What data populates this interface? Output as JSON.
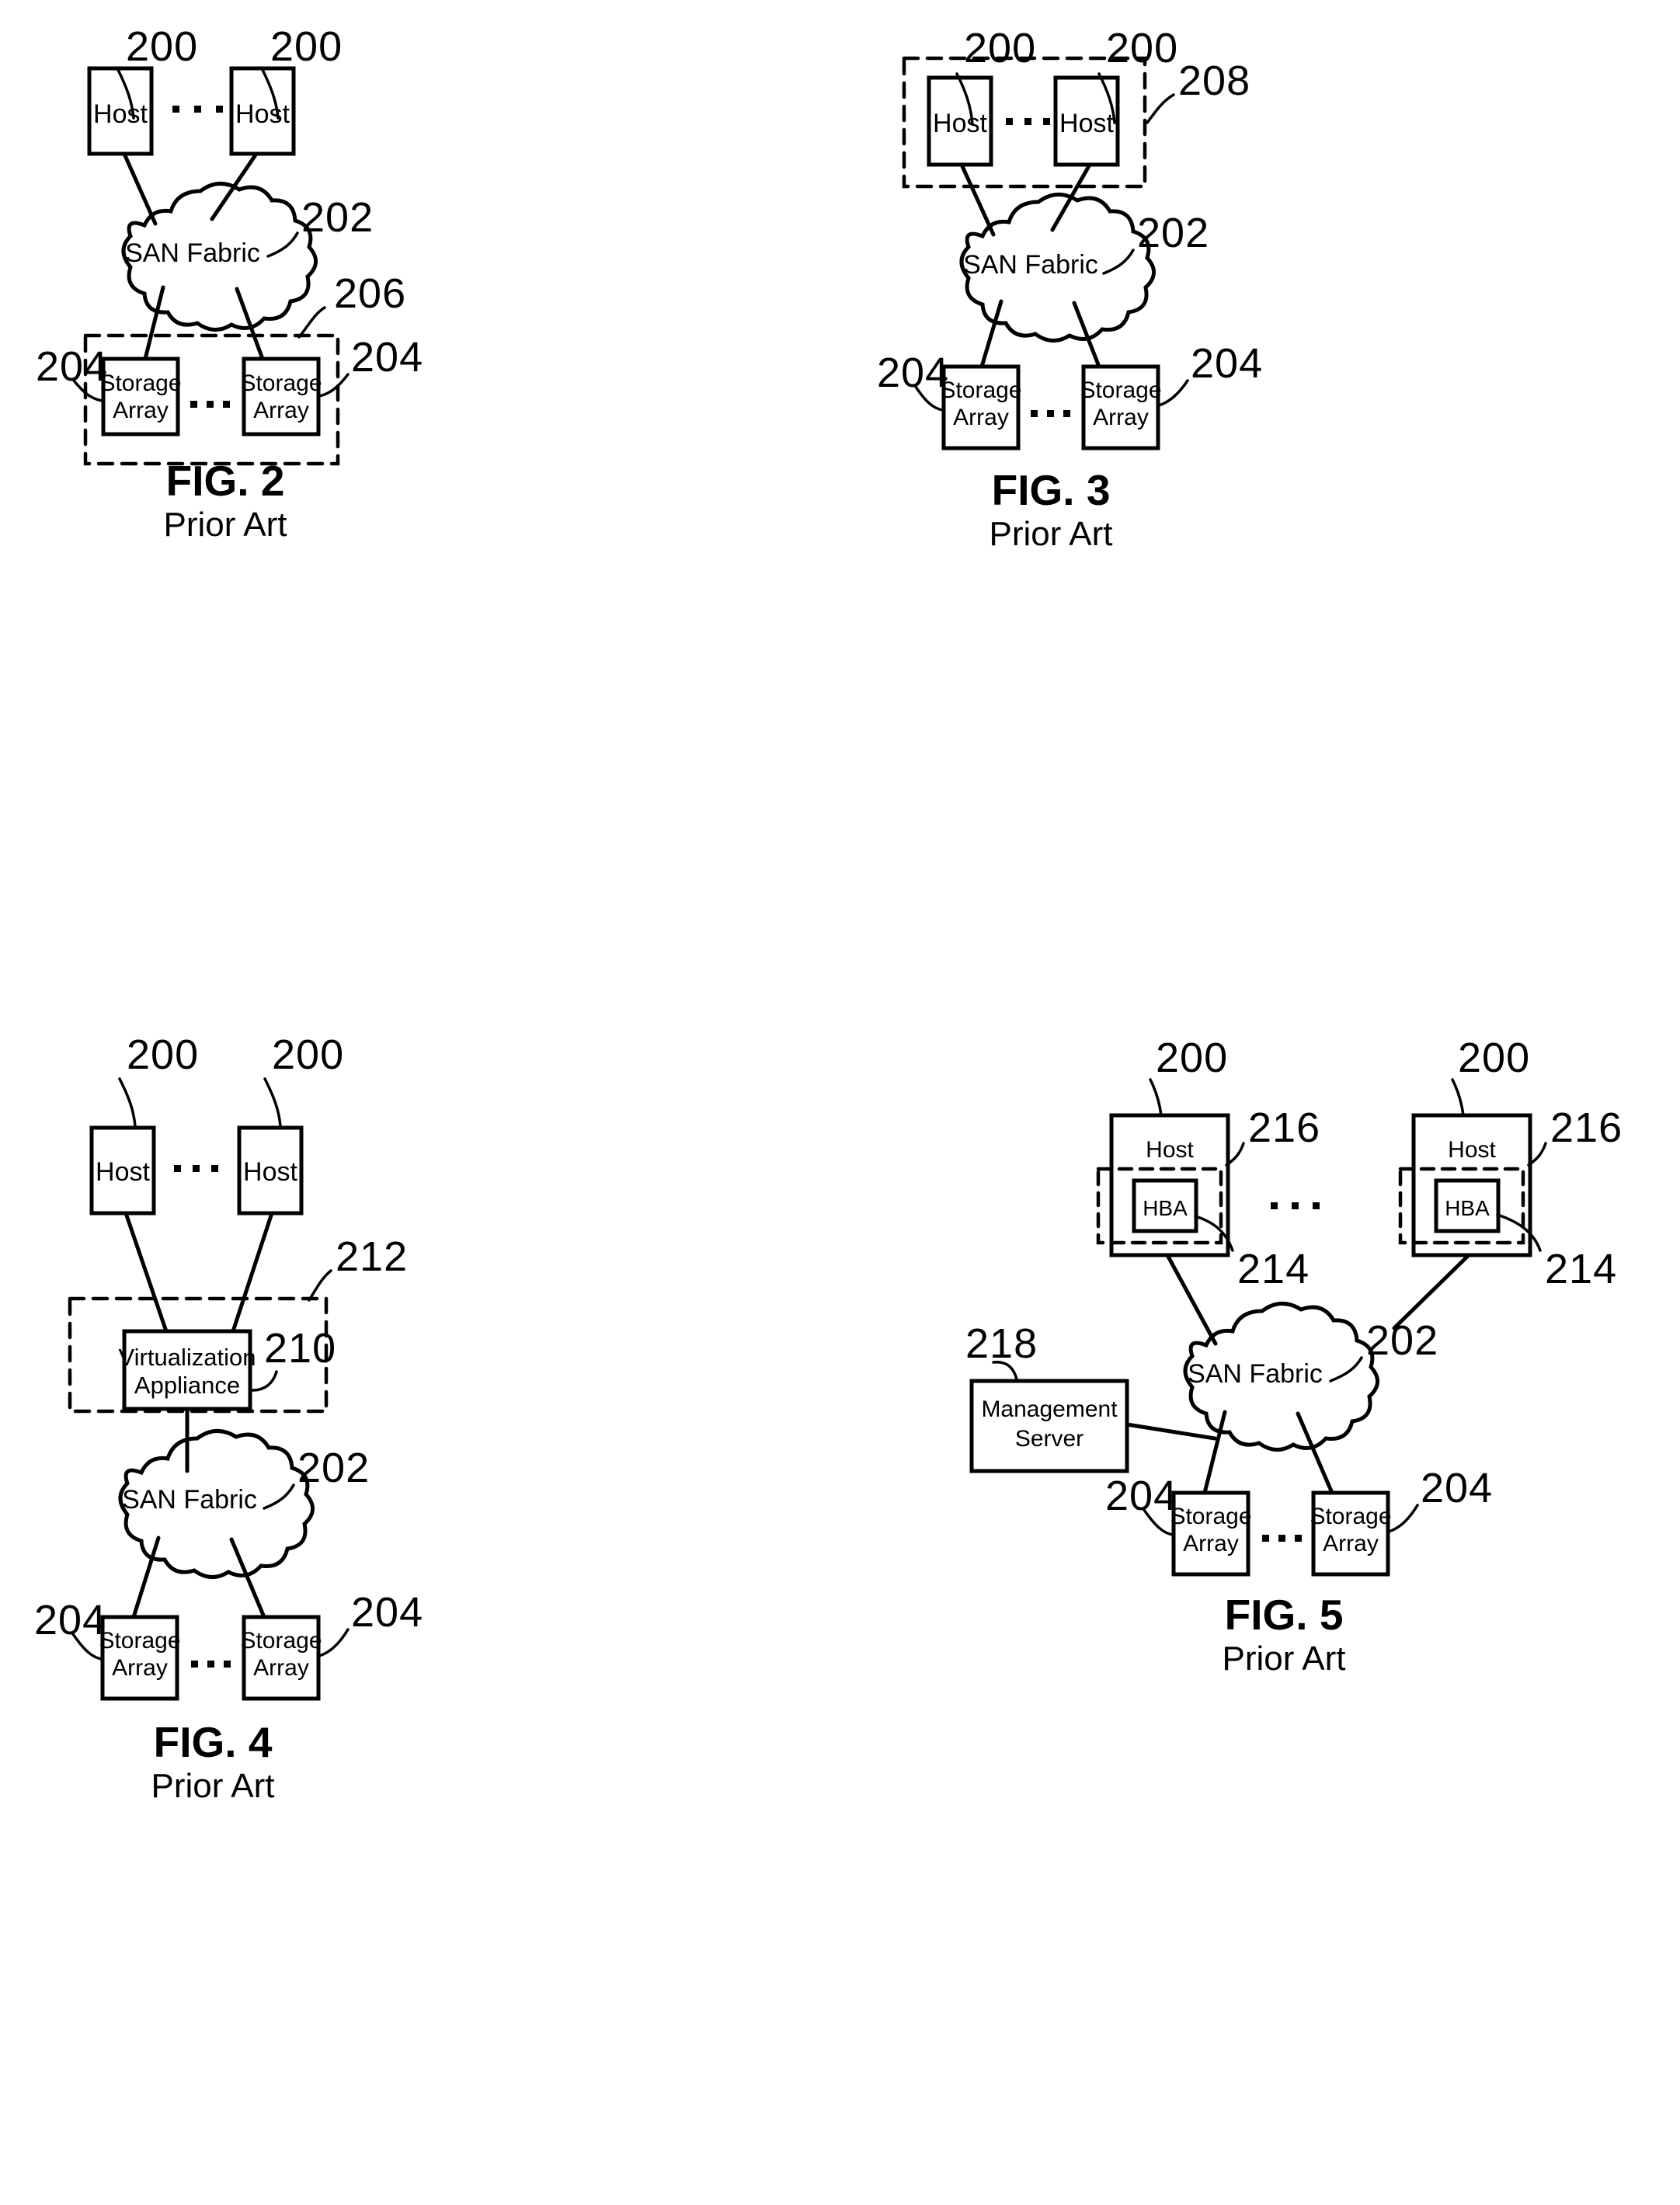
{
  "document": {
    "type": "patent-drawing-sheet",
    "sheet_background": "#ffffff",
    "line_color": "#000000"
  },
  "labels": {
    "host": "Host",
    "san_fabric": "SAN Fabric",
    "storage_array_line1": "Storage",
    "storage_array_line2": "Array",
    "virtualization_line1": "Virtualization",
    "virtualization_line2": "Appliance",
    "management_line1": "Management",
    "management_line2": "Server",
    "hba": "HBA",
    "ellipsis": "• • •"
  },
  "reference_numerals": {
    "host": "200",
    "san_fabric": "202",
    "storage_array": "204",
    "storage_group": "206",
    "host_group": "208",
    "virtualization_appliance": "210",
    "virtualization_group": "212",
    "hba": "214",
    "hba_group": "216",
    "management_server": "218"
  },
  "figures": [
    {
      "id": "fig2",
      "title": "FIG. 2",
      "subtitle": "Prior Art",
      "nodes": [
        {
          "name": "host-left",
          "label": "Host",
          "ref": "200"
        },
        {
          "name": "host-right",
          "label": "Host",
          "ref": "200"
        },
        {
          "name": "san-fabric",
          "label": "SAN Fabric",
          "ref": "202"
        },
        {
          "name": "storage-array-left",
          "label": "Storage Array",
          "ref": "204"
        },
        {
          "name": "storage-array-right",
          "label": "Storage Array",
          "ref": "204"
        }
      ],
      "groups": [
        {
          "name": "storage-group",
          "ref": "206",
          "style": "dashed",
          "contains": [
            "storage-array-left",
            "storage-array-right"
          ]
        }
      ]
    },
    {
      "id": "fig3",
      "title": "FIG. 3",
      "subtitle": "Prior Art",
      "nodes": [
        {
          "name": "host-left",
          "label": "Host",
          "ref": "200"
        },
        {
          "name": "host-right",
          "label": "Host",
          "ref": "200"
        },
        {
          "name": "san-fabric",
          "label": "SAN Fabric",
          "ref": "202"
        },
        {
          "name": "storage-array-left",
          "label": "Storage Array",
          "ref": "204"
        },
        {
          "name": "storage-array-right",
          "label": "Storage Array",
          "ref": "204"
        }
      ],
      "groups": [
        {
          "name": "host-group",
          "ref": "208",
          "style": "dashed",
          "contains": [
            "host-left",
            "host-right"
          ]
        }
      ]
    },
    {
      "id": "fig4",
      "title": "FIG. 4",
      "subtitle": "Prior Art",
      "nodes": [
        {
          "name": "host-left",
          "label": "Host",
          "ref": "200"
        },
        {
          "name": "host-right",
          "label": "Host",
          "ref": "200"
        },
        {
          "name": "virtualization-appliance",
          "label": "Virtualization Appliance",
          "ref": "210"
        },
        {
          "name": "san-fabric",
          "label": "SAN Fabric",
          "ref": "202"
        },
        {
          "name": "storage-array-left",
          "label": "Storage Array",
          "ref": "204"
        },
        {
          "name": "storage-array-right",
          "label": "Storage Array",
          "ref": "204"
        }
      ],
      "groups": [
        {
          "name": "virtualization-group",
          "ref": "212",
          "style": "dashed",
          "contains": [
            "virtualization-appliance"
          ]
        }
      ]
    },
    {
      "id": "fig5",
      "title": "FIG. 5",
      "subtitle": "Prior Art",
      "nodes": [
        {
          "name": "host-left",
          "label": "Host",
          "ref": "200"
        },
        {
          "name": "hba-left",
          "label": "HBA",
          "ref": "214"
        },
        {
          "name": "host-right",
          "label": "Host",
          "ref": "200"
        },
        {
          "name": "hba-right",
          "label": "HBA",
          "ref": "214"
        },
        {
          "name": "management-server",
          "label": "Management Server",
          "ref": "218"
        },
        {
          "name": "san-fabric",
          "label": "SAN Fabric",
          "ref": "202"
        },
        {
          "name": "storage-array-left",
          "label": "Storage Array",
          "ref": "204"
        },
        {
          "name": "storage-array-right",
          "label": "Storage Array",
          "ref": "204"
        }
      ],
      "groups": [
        {
          "name": "hba-group-left",
          "ref": "216",
          "style": "dashed",
          "contains": [
            "hba-left"
          ]
        },
        {
          "name": "hba-group-right",
          "ref": "216",
          "style": "dashed",
          "contains": [
            "hba-right"
          ]
        }
      ]
    }
  ]
}
